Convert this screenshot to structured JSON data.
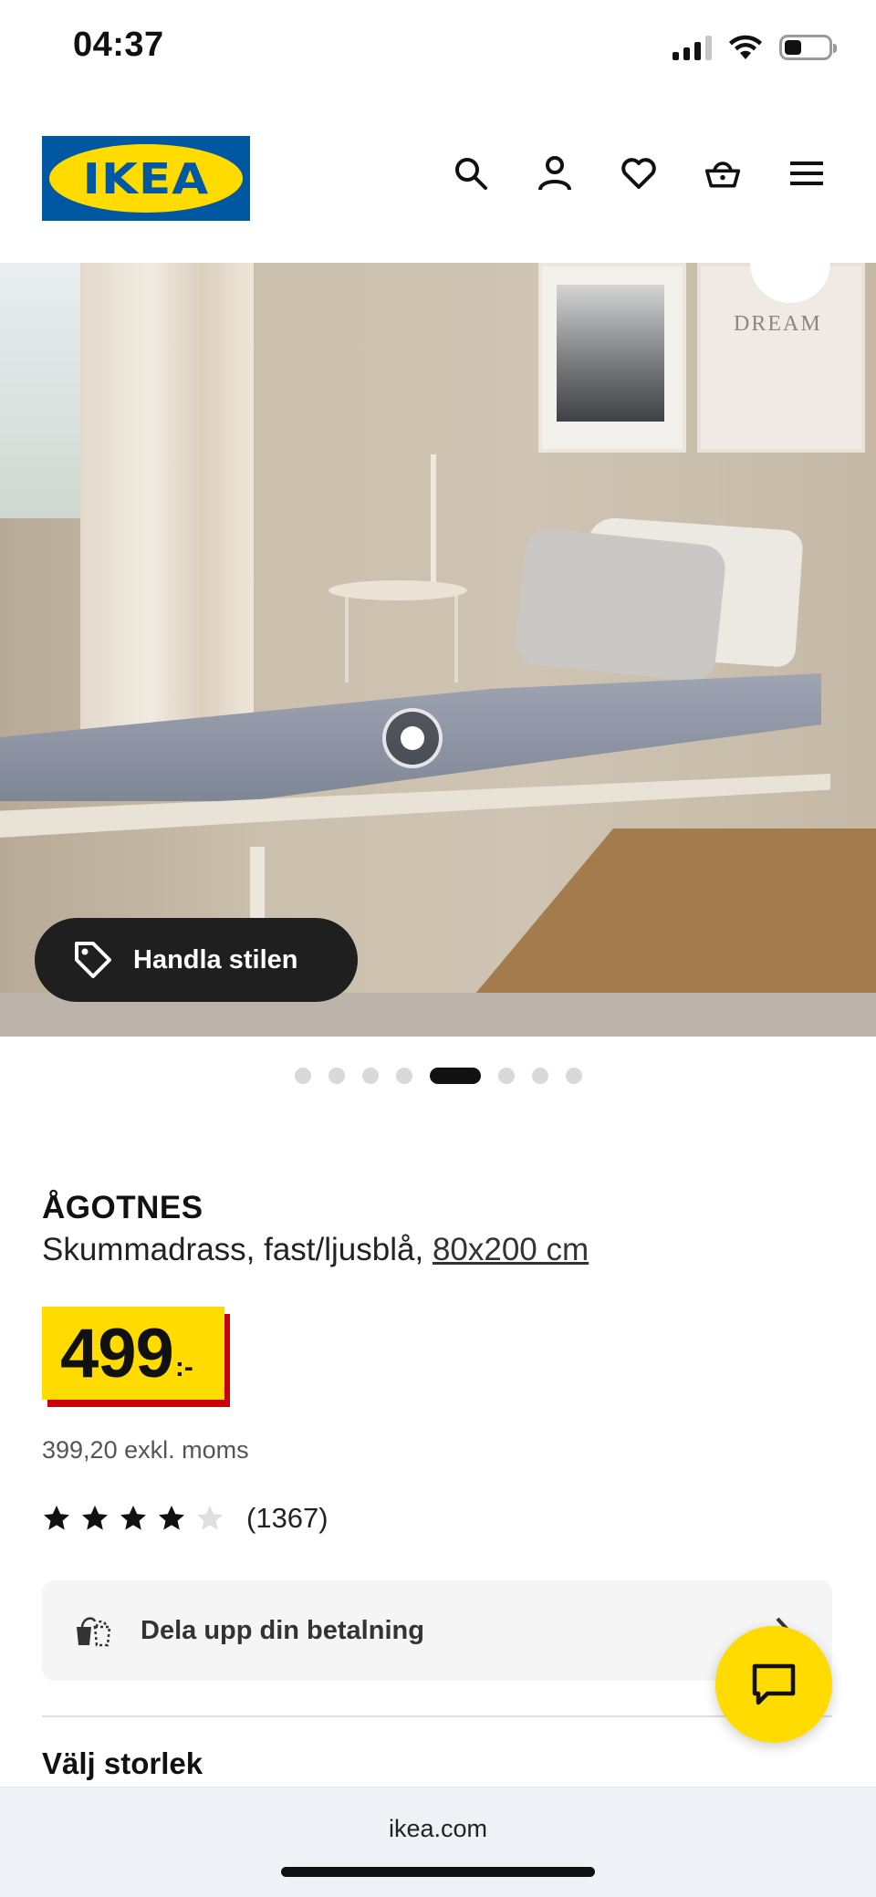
{
  "status_bar": {
    "time": "04:37",
    "icons": [
      "cellular-signal-icon",
      "wifi-icon",
      "battery-icon"
    ]
  },
  "header": {
    "logo_text": "IKEA",
    "icons": [
      "search-icon",
      "account-icon",
      "heart-icon",
      "basket-icon",
      "menu-icon"
    ]
  },
  "hero": {
    "poster_text": "DREAM",
    "shop_style_label": "Handla stilen",
    "carousel": {
      "total": 8,
      "active_index": 4
    }
  },
  "product": {
    "name": "ÅGOTNES",
    "description": "Skummadrass, fast/ljusblå, ",
    "size": "80x200 cm",
    "price": "499",
    "currency": ":-",
    "price_excl_vat": "399,20 exkl. moms",
    "rating": {
      "stars": 4,
      "max": 5,
      "count": "(1367)"
    }
  },
  "payment": {
    "label": "Dela upp din betalning"
  },
  "section": {
    "choose_size": "Välj storlek"
  },
  "browser": {
    "url": "ikea.com"
  },
  "colors": {
    "ikea_blue": "#0058a3",
    "ikea_yellow": "#ffdb00",
    "price_red": "#cc0008"
  }
}
